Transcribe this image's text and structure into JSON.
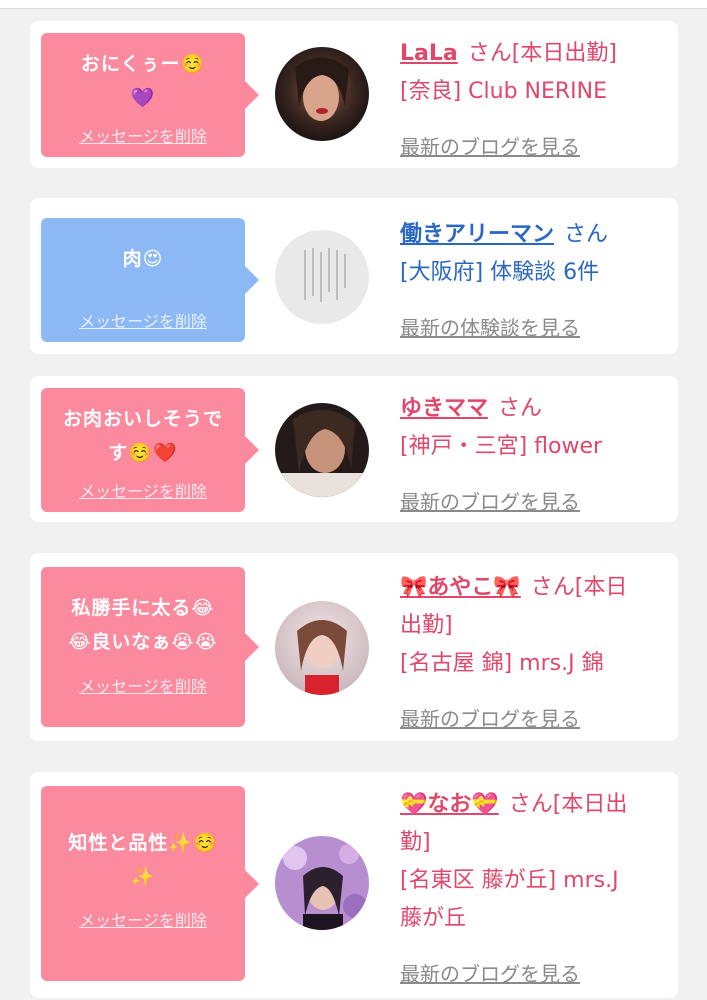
{
  "colors": {
    "pink_bubble": "#fb8a9e",
    "blue_bubble": "#8cb9f5",
    "pink_text": "#e0476b",
    "blue_text": "#2a67c4",
    "link_gray": "#8a8a8a"
  },
  "cards": [
    {
      "message_line1": "おにくぅー☺️",
      "message_line2": "💜",
      "delete_label": "メッセージを削除",
      "name": "LaLa",
      "suffix": "さん[本日出勤]",
      "shop": "[奈良] Club NERINE",
      "blog_link": "最新のブログを見る",
      "avatar_icon": "profile-photo"
    },
    {
      "message_line1": "肉😍",
      "delete_label": "メッセージを削除",
      "name": "働きアリーマン",
      "suffix": "さん",
      "shop": "[大阪府] 体験談 6件",
      "blog_link": "最新の体験談を見る",
      "avatar_icon": "profile-photo"
    },
    {
      "message_line1": "お肉おいしそうで",
      "message_line2": "す☺️❤️",
      "delete_label": "メッセージを削除",
      "name": "ゆきママ",
      "suffix": "さん",
      "shop": "[神戸・三宮] flower",
      "blog_link": "最新のブログを見る",
      "avatar_icon": "profile-photo"
    },
    {
      "message_line1": "私勝手に太る😂",
      "message_line2": "😂良いなぁ😭😭",
      "delete_label": "メッセージを削除",
      "name": "🎀あやこ🎀",
      "suffix": "さん[本日",
      "suffix_line2": "出勤]",
      "shop": "[名古屋 錦] mrs.J 錦",
      "blog_link": "最新のブログを見る",
      "avatar_icon": "profile-photo"
    },
    {
      "message_line1": "知性と品性✨☺️",
      "message_line2": "✨",
      "delete_label": "メッセージを削除",
      "name": "💝なお💝",
      "suffix": "さん[本日出",
      "suffix_line2": "勤]",
      "shop": "[名東区 藤が丘] mrs.J",
      "shop_line2": "藤が丘",
      "blog_link": "最新のブログを見る",
      "avatar_icon": "profile-photo"
    }
  ]
}
